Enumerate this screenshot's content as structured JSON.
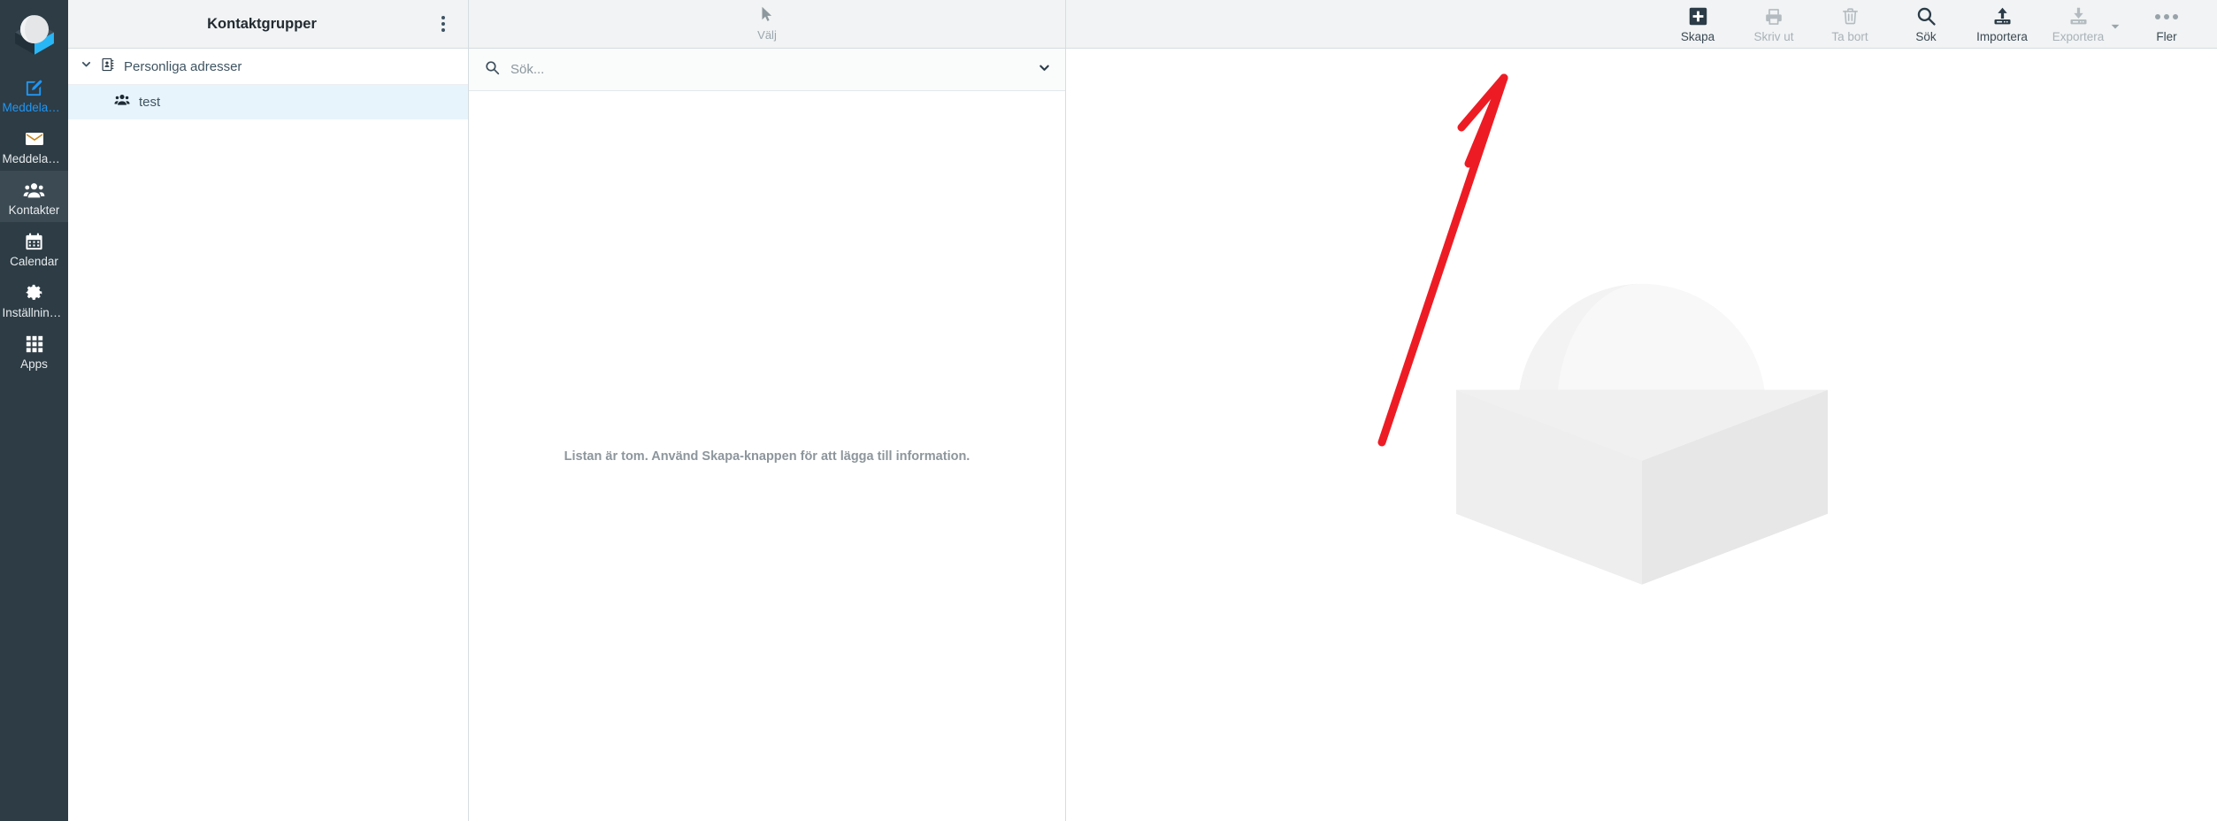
{
  "rail": {
    "logo_icon": "app-logo-cube-sphere",
    "items": [
      {
        "label": "Meddelande",
        "icon": "compose-icon",
        "state": "accent"
      },
      {
        "label": "Meddeland...",
        "icon": "mail-envelope-icon",
        "state": "normal"
      },
      {
        "label": "Kontakter",
        "icon": "contacts-group-icon",
        "state": "selected"
      },
      {
        "label": "Calendar",
        "icon": "calendar-icon",
        "state": "normal"
      },
      {
        "label": "Inställningar",
        "icon": "gear-icon",
        "state": "normal"
      },
      {
        "label": "Apps",
        "icon": "apps-grid-icon",
        "state": "normal"
      }
    ]
  },
  "groups_panel": {
    "title": "Kontaktgrupper",
    "kebab_icon": "more-vertical-icon",
    "section": {
      "label": "Personliga adresser",
      "icon": "address-book-icon",
      "chevron": "chevron-down-icon",
      "expanded": true
    },
    "rows": [
      {
        "label": "test",
        "icon": "contacts-group-icon",
        "active": true
      }
    ]
  },
  "contacts_panel": {
    "select_button": {
      "label": "Välj",
      "icon": "cursor-arrow-icon",
      "disabled": true
    },
    "search": {
      "placeholder": "Sök...",
      "value": "",
      "icon": "search-icon",
      "dropdown_icon": "chevron-down-icon"
    },
    "empty_message": "Listan är tom. Använd Skapa-knappen för att lägga till information."
  },
  "toolbar": {
    "buttons": [
      {
        "label": "Skapa",
        "icon": "plus-square-icon",
        "disabled": false
      },
      {
        "label": "Skriv ut",
        "icon": "printer-icon",
        "disabled": true
      },
      {
        "label": "Ta bort",
        "icon": "trash-icon",
        "disabled": true
      },
      {
        "label": "Sök",
        "icon": "search-icon",
        "disabled": false
      },
      {
        "label": "Importera",
        "icon": "upload-icon",
        "disabled": false
      },
      {
        "label": "Exportera",
        "icon": "download-icon",
        "disabled": true
      },
      {
        "label": "Fler",
        "icon": "more-horizontal-icon",
        "disabled": false
      }
    ],
    "export_caret_icon": "chevron-down-icon"
  },
  "detail_panel": {
    "watermark_icon": "app-logo-cube-sphere-watermark"
  },
  "annotation": {
    "type": "arrow",
    "color": "#ed1c24",
    "points_to": "Skapa"
  },
  "colors": {
    "rail_bg": "#2d3c45",
    "rail_selected_bg": "#3b4a53",
    "accent_blue": "#2196f3",
    "header_bg": "#f1f3f4",
    "row_active_bg": "#e8f4fc",
    "border": "#d6dde1",
    "annotation_red": "#ed1c24"
  }
}
